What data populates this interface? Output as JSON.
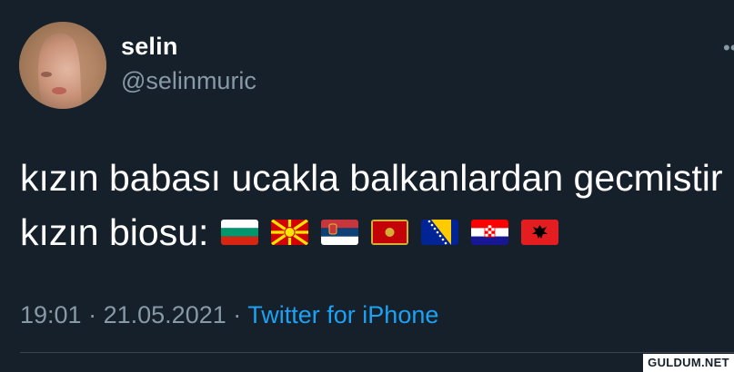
{
  "tweet": {
    "author": {
      "display_name": "selin",
      "handle": "@selinmuric"
    },
    "text_line1": "kızın babası ucakla balkanlardan gecmistir",
    "text_line2": "kızın biosu:",
    "flags": [
      "Bulgaria",
      "North Macedonia",
      "Serbia",
      "Montenegro",
      "Bosnia and Herzegovina",
      "Croatia",
      "Albania"
    ],
    "time": "19:01",
    "separator": "·",
    "date": "21.05.2021",
    "source": "Twitter for iPhone"
  },
  "watermark": "GULDUM.NET",
  "colors": {
    "background": "#15202b",
    "secondary_text": "#8899a6",
    "link": "#1da1f2"
  }
}
